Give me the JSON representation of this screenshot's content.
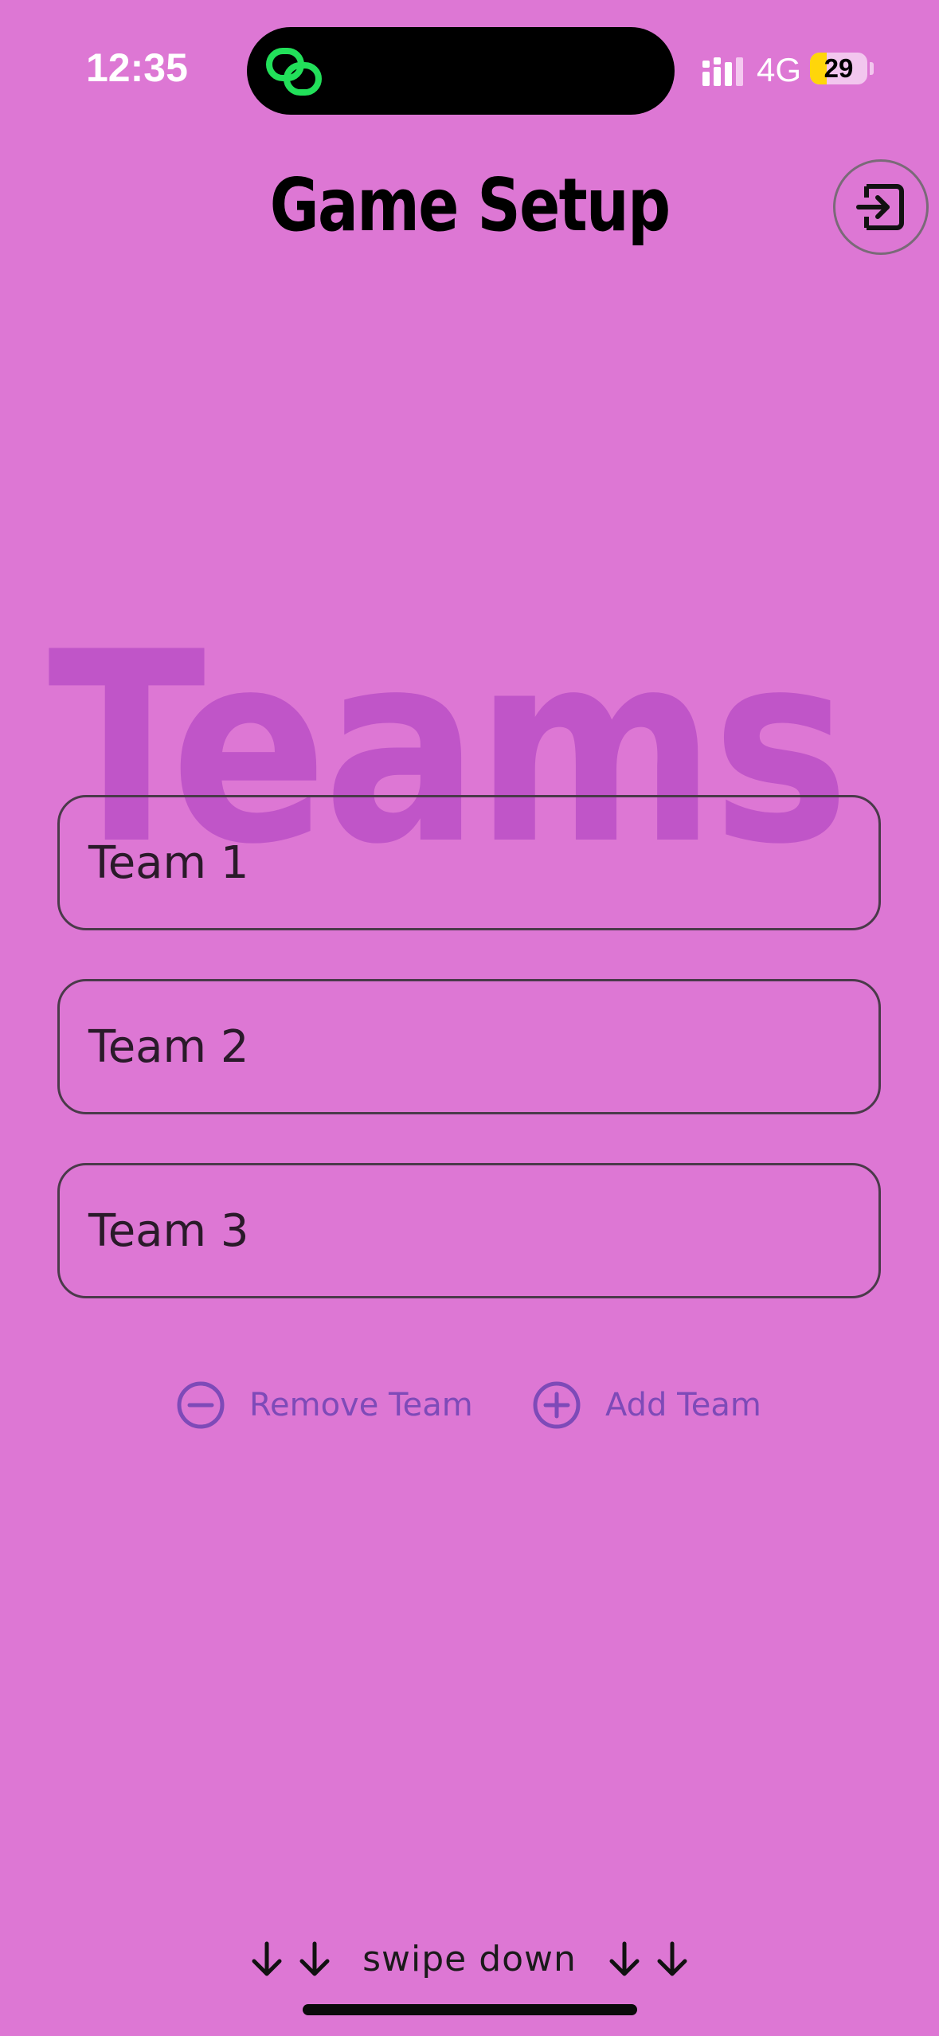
{
  "status_bar": {
    "time": "12:35",
    "network": "4G",
    "battery_level": "29",
    "battery_fraction": 0.29,
    "island_icon": "link-icon"
  },
  "header": {
    "title": "Game Setup",
    "exit_icon": "exit-icon"
  },
  "section": {
    "background_title": "Teams"
  },
  "teams": [
    {
      "name": "Team 1"
    },
    {
      "name": "Team 2"
    },
    {
      "name": "Team 3"
    }
  ],
  "actions": {
    "remove_label": "Remove Team",
    "remove_icon": "minus-circle-icon",
    "add_label": "Add Team",
    "add_icon": "plus-circle-icon"
  },
  "footer": {
    "swipe_label": "swipe down",
    "arrow_icon": "arrow-down-icon"
  },
  "colors": {
    "background": "#DD77D4",
    "accent": "#7E4AB8",
    "island_icon": "#22E05A",
    "battery": "#FFD60A"
  }
}
